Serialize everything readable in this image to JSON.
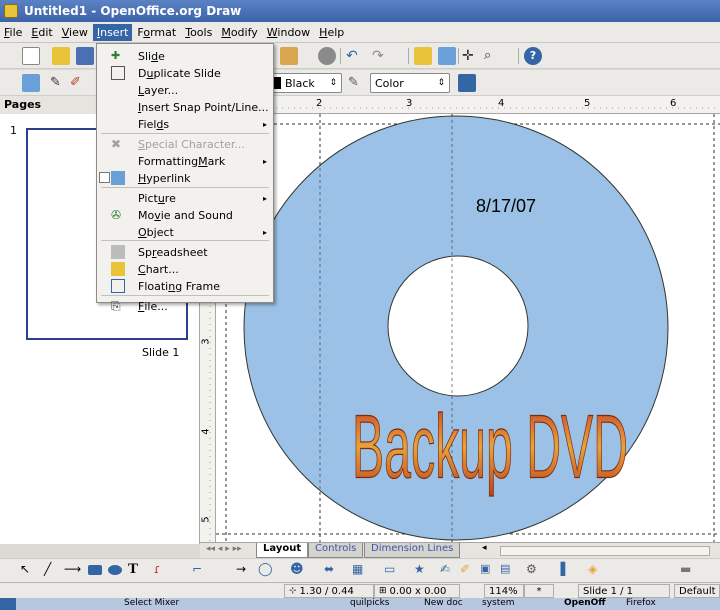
{
  "window": {
    "title": "Untitled1 - OpenOffice.org Draw"
  },
  "menubar": {
    "items": [
      {
        "pre": "",
        "ul": "F",
        "post": "ile"
      },
      {
        "pre": "",
        "ul": "E",
        "post": "dit"
      },
      {
        "pre": "",
        "ul": "V",
        "post": "iew"
      },
      {
        "pre": "",
        "ul": "I",
        "post": "nsert"
      },
      {
        "pre": "F",
        "ul": "o",
        "post": "rmat"
      },
      {
        "pre": "",
        "ul": "T",
        "post": "ools"
      },
      {
        "pre": "",
        "ul": "M",
        "post": "odify"
      },
      {
        "pre": "",
        "ul": "W",
        "post": "indow"
      },
      {
        "pre": "",
        "ul": "H",
        "post": "elp"
      }
    ],
    "active_index": 3
  },
  "toolbar2": {
    "line_color": "Black",
    "area_style": "Color"
  },
  "insert_menu": {
    "items": [
      {
        "pre": "Sli",
        "ul": "d",
        "post": "e",
        "disabled": false,
        "submenu": false,
        "icon": "slide-icon"
      },
      {
        "pre": "D",
        "ul": "u",
        "post": "plicate Slide",
        "disabled": false,
        "submenu": false,
        "icon": "duplicate-slide-icon"
      },
      {
        "pre": "",
        "ul": "L",
        "post": "ayer...",
        "disabled": false,
        "submenu": false,
        "icon": ""
      },
      {
        "pre": "",
        "ul": "I",
        "post": "nsert Snap Point/Line...",
        "disabled": false,
        "submenu": false,
        "icon": ""
      },
      {
        "pre": "Fiel",
        "ul": "d",
        "post": "s",
        "disabled": false,
        "submenu": true,
        "icon": ""
      },
      {
        "pre": "",
        "ul": "S",
        "post": "pecial Character...",
        "disabled": true,
        "submenu": false,
        "icon": "special-character-icon"
      },
      {
        "pre": "Formatting ",
        "ul": "M",
        "post": "ark",
        "disabled": false,
        "submenu": true,
        "icon": ""
      },
      {
        "pre": "",
        "ul": "H",
        "post": "yperlink",
        "disabled": false,
        "submenu": false,
        "icon": "hyperlink-icon"
      },
      {
        "pre": "Pict",
        "ul": "u",
        "post": "re",
        "disabled": false,
        "submenu": true,
        "icon": ""
      },
      {
        "pre": "Mo",
        "ul": "v",
        "post": "ie and Sound",
        "disabled": false,
        "submenu": false,
        "icon": "movie-sound-icon"
      },
      {
        "pre": "",
        "ul": "O",
        "post": "bject",
        "disabled": false,
        "submenu": true,
        "icon": ""
      },
      {
        "pre": "Sp",
        "ul": "r",
        "post": "eadsheet",
        "disabled": false,
        "submenu": false,
        "icon": "spreadsheet-icon"
      },
      {
        "pre": "",
        "ul": "C",
        "post": "hart...",
        "disabled": false,
        "submenu": false,
        "icon": "chart-icon"
      },
      {
        "pre": "Floati",
        "ul": "n",
        "post": "g Frame",
        "disabled": false,
        "submenu": false,
        "icon": "floating-frame-icon"
      },
      {
        "pre": "",
        "ul": "F",
        "post": "ile...",
        "disabled": false,
        "submenu": false,
        "icon": "file-icon"
      }
    ]
  },
  "pages_panel": {
    "header": "Pages",
    "slide_number": "1",
    "slide_label": "Slide 1"
  },
  "rulers": {
    "h_ticks": [
      "2",
      "3",
      "4",
      "5",
      "6"
    ],
    "v_ticks": [
      "3",
      "4",
      "5"
    ]
  },
  "canvas": {
    "date_text": "8/17/07",
    "title_text": "Backup DVD",
    "disc_color": "#9bc2e6"
  },
  "tabs": [
    "Layout",
    "Controls",
    "Dimension Lines"
  ],
  "statusbar": {
    "position": "1.30 / 0.44",
    "size": "0.00 x 0.00",
    "zoom": "114%",
    "modified": "*",
    "slide": "Slide 1 / 1",
    "layout": "Default"
  },
  "taskbar": {
    "items": [
      "Select Mixer",
      "quilpicks",
      "New doc",
      "system",
      "OpenOff",
      "Firefox"
    ]
  }
}
